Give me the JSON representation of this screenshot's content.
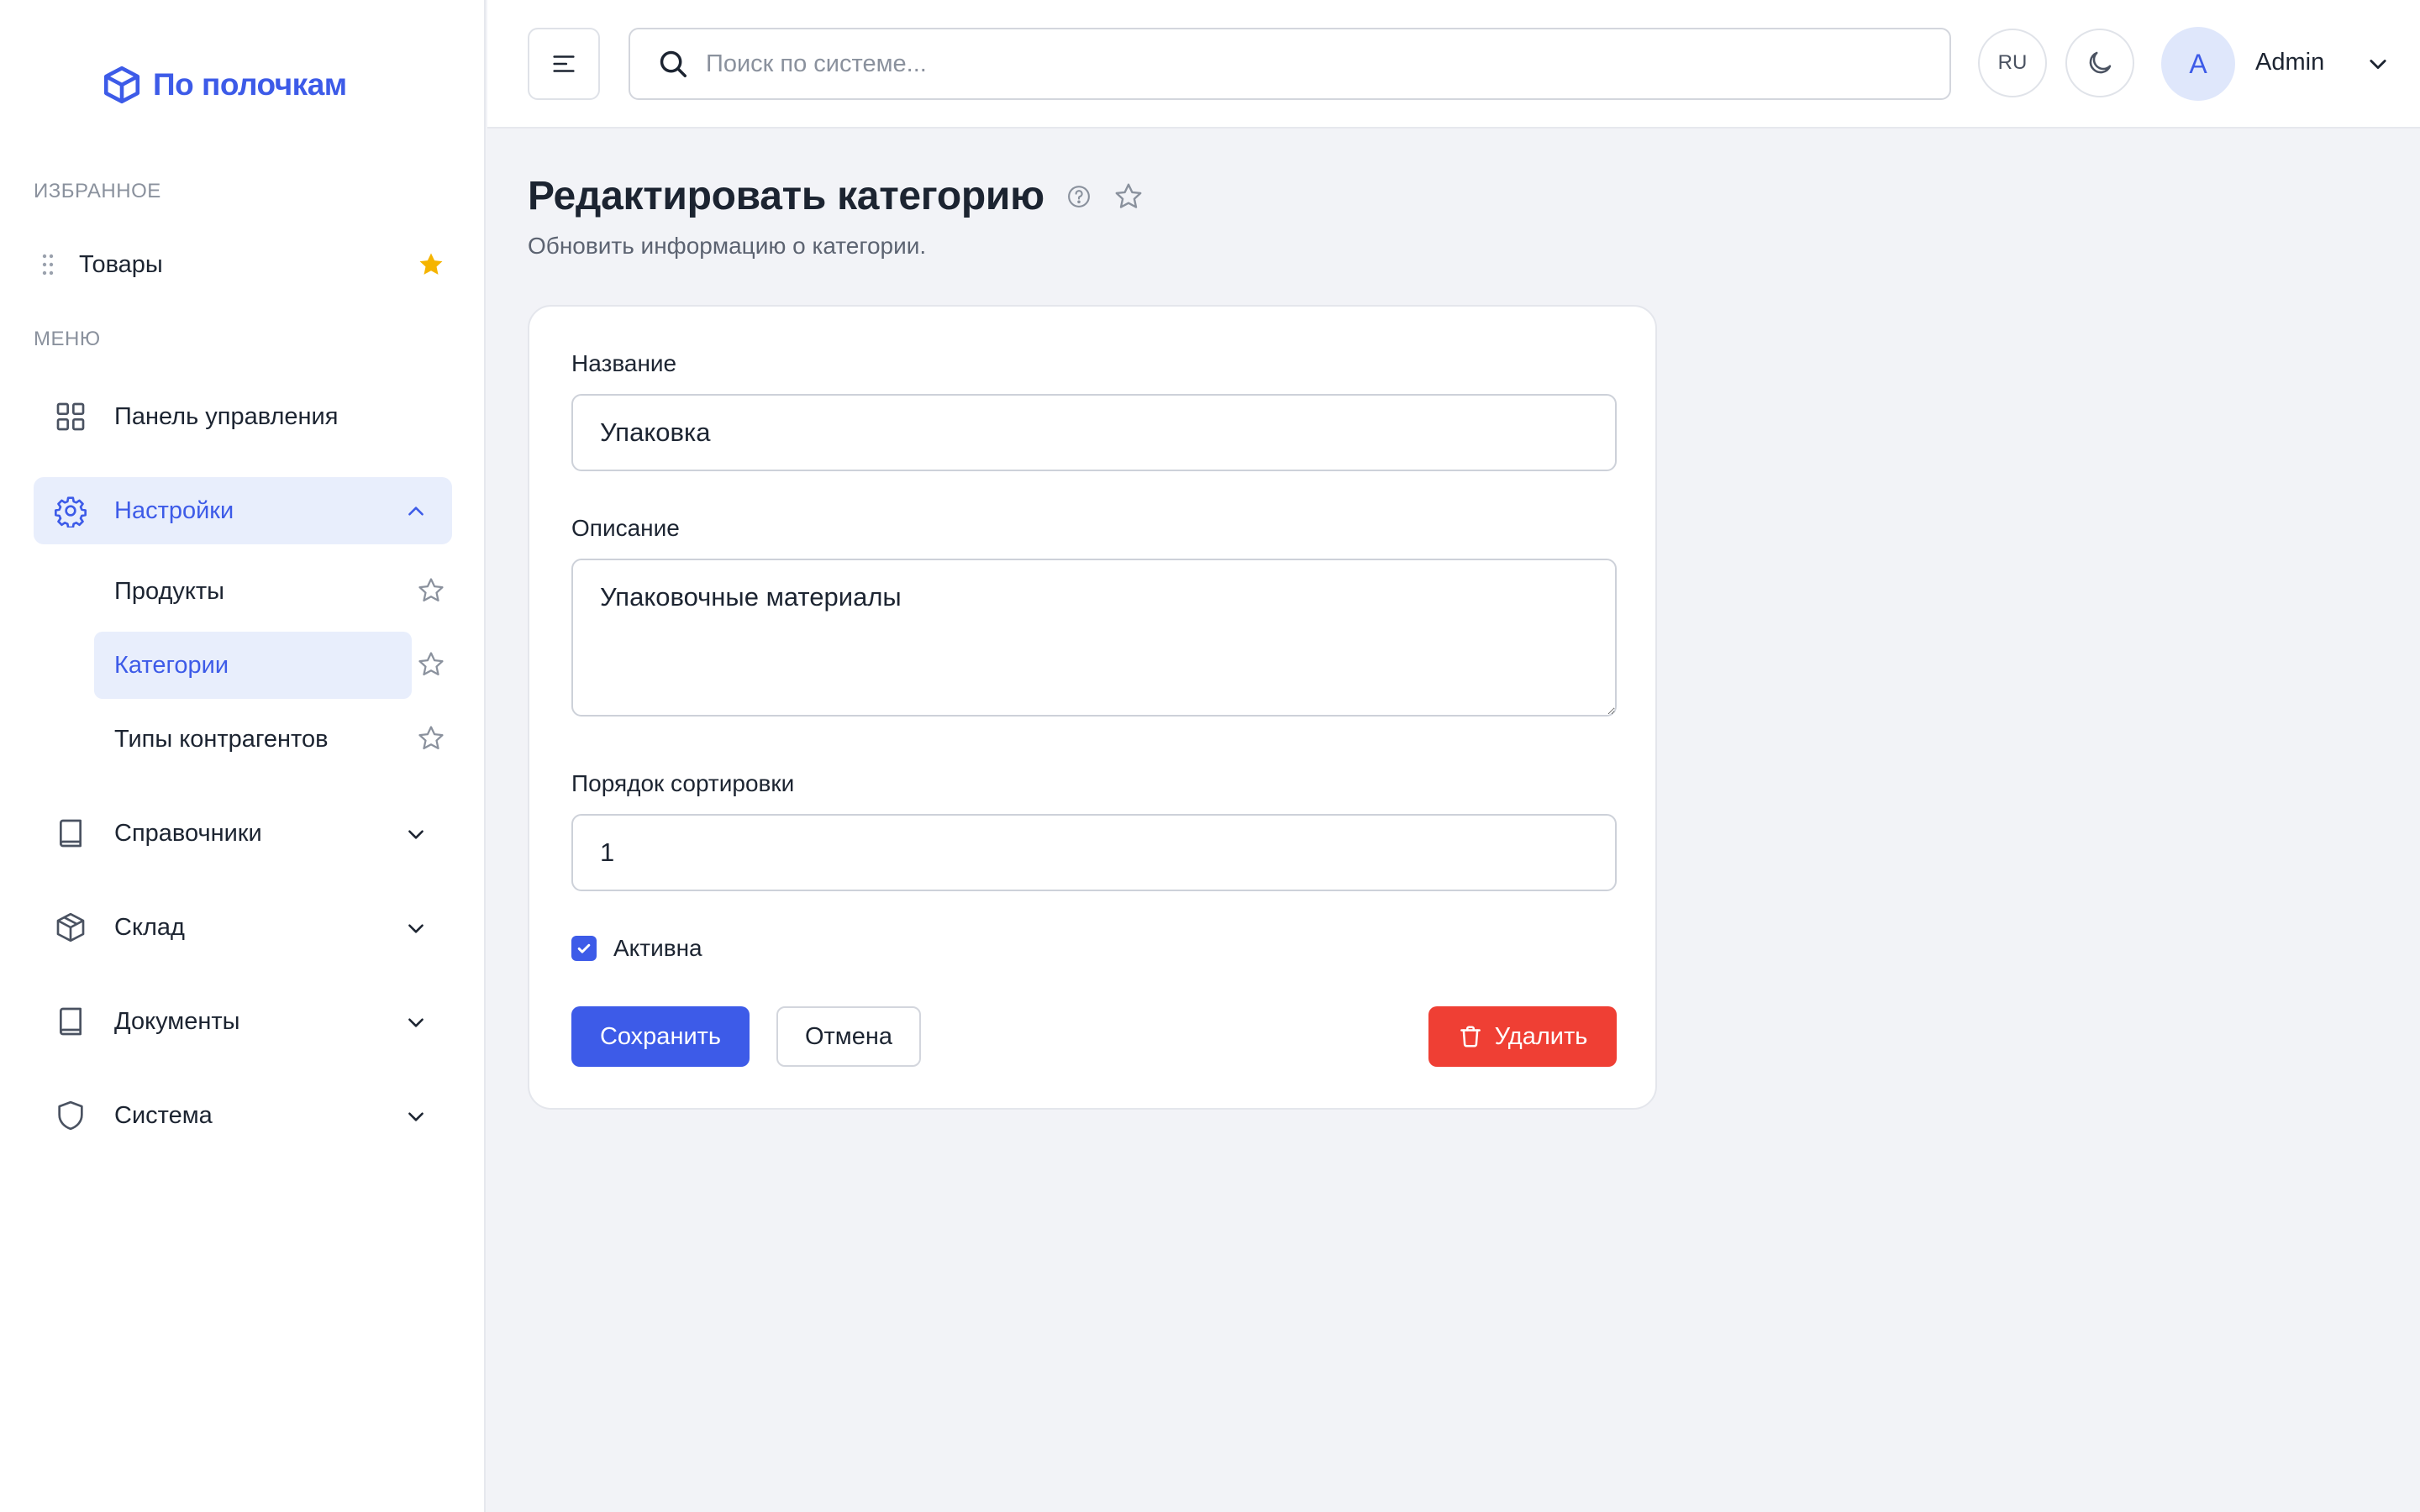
{
  "app": {
    "logo_text": "По полочкам",
    "brand_color": "#3d5be8"
  },
  "sidebar": {
    "favorites_title": "ИЗБРАННОЕ",
    "favorites": [
      {
        "label": "Товары",
        "icon": "star-filled-icon"
      }
    ],
    "menu_title": "МЕНЮ",
    "items": [
      {
        "label": "Панель управления",
        "icon": "dashboard-grid-icon"
      },
      {
        "label": "Настройки",
        "icon": "gear-icon",
        "expanded": true,
        "children": [
          {
            "label": "Продукты"
          },
          {
            "label": "Категории",
            "active": true
          },
          {
            "label": "Типы контрагентов"
          }
        ]
      },
      {
        "label": "Справочники",
        "icon": "book-icon"
      },
      {
        "label": "Склад",
        "icon": "box-icon"
      },
      {
        "label": "Документы",
        "icon": "book-icon"
      },
      {
        "label": "Система",
        "icon": "shield-icon"
      }
    ]
  },
  "header": {
    "search_placeholder": "Поиск по системе...",
    "language": "RU",
    "avatar_initial": "A",
    "user_name": "Admin"
  },
  "page": {
    "title": "Редактировать категорию",
    "subtitle": "Обновить информацию о категории."
  },
  "form": {
    "name_label": "Название",
    "name_value": "Упаковка",
    "description_label": "Описание",
    "description_value": "Упаковочные материалы",
    "sort_label": "Порядок сортировки",
    "sort_value": "1",
    "active_label": "Активна",
    "active_checked": true,
    "save_label": "Сохранить",
    "cancel_label": "Отмена",
    "delete_label": "Удалить"
  },
  "colors": {
    "accent": "#3d5be8",
    "danger": "#ef3f34",
    "favorite_star": "#f5b400"
  }
}
